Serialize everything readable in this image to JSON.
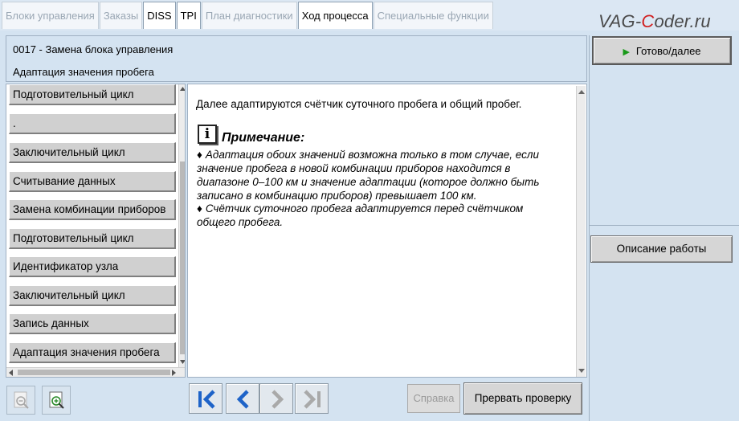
{
  "tabs": [
    {
      "label": "Блоки управления",
      "state": "disabled"
    },
    {
      "label": "Заказы",
      "state": "disabled"
    },
    {
      "label": "DISS",
      "state": "enabled"
    },
    {
      "label": "TPI",
      "state": "enabled"
    },
    {
      "label": "План диагностики",
      "state": "disabled"
    },
    {
      "label": "Ход процесса",
      "state": "active"
    },
    {
      "label": "Специальные функции",
      "state": "disabled"
    }
  ],
  "logo": {
    "prefix": "VAG-",
    "accent": "C",
    "suffix": "oder.ru"
  },
  "header": {
    "title": "0017 - Замена блока управления",
    "subtitle": "Адаптация значения пробега"
  },
  "steps": [
    "Подготовительный цикл",
    ".",
    "Заключительный цикл",
    "Считывание данных",
    "Замена комбинации приборов",
    "Подготовительный цикл",
    "Идентификатор узла",
    "Заключительный цикл",
    "Запись данных",
    "Адаптация значения пробега"
  ],
  "content": {
    "lead": "Далее адаптируются счётчик суточного пробега и общий пробег.",
    "note_icon": "i",
    "note_title": "Примечание:",
    "bullets": [
      {
        "dot": "♦",
        "lines": [
          "Адаптация обоих значений возможна только в том случае, если",
          "значение пробега в новой комбинации приборов находится в",
          "диапазоне 0–100 км и значение адаптации (которое должно быть",
          "записано в комбинацию приборов) превышает 100 км."
        ]
      },
      {
        "dot": "♦",
        "lines": [
          "Счётчик суточного пробега адаптируется перед счётчиком",
          "общего пробега."
        ]
      }
    ]
  },
  "buttons": {
    "done": "Готово/далее",
    "description": "Описание работы",
    "help": "Справка",
    "abort": "Прервать проверку"
  },
  "icons": {
    "done_play": "play-icon",
    "nav": [
      "first-icon",
      "prev-icon",
      "next-icon",
      "last-icon"
    ],
    "zoom": [
      "zoom-out-icon",
      "zoom-in-icon"
    ]
  },
  "colors": {
    "accent_blue": "#1e63c8",
    "play_green": "#1a9a1a",
    "logo_red": "#d12020",
    "background": "#d4e3f1"
  }
}
